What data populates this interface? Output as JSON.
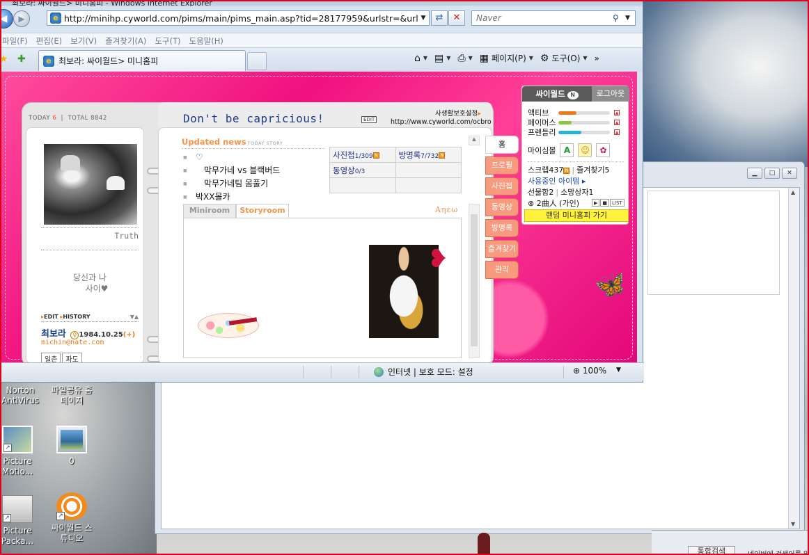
{
  "colors": {
    "border_red": "#d9041b",
    "cy_pink": "#f0117f",
    "title_blue": "#1c3a8c",
    "accent_orange": "#f4944d",
    "random_yellow": "#fff23c"
  },
  "window": {
    "title": "최보라: 싸이월드> 미니홈피 - Windows Internet Explorer"
  },
  "address_bar": {
    "url": "http://minihp.cyworld.com/pims/main/pims_main.asp?tid=28177959&urlstr=&urlstrsub=",
    "search_placeholder": "Naver"
  },
  "menu": [
    "파일(F)",
    "편집(E)",
    "보기(V)",
    "즐겨찾기(A)",
    "도구(T)",
    "도움말(H)"
  ],
  "tab": {
    "label": "최보라: 싸이월드> 미니홈피"
  },
  "command_bar": {
    "page_label": "페이지(P)",
    "tools_label": "도구(O)",
    "more": "»"
  },
  "minihompy": {
    "counter": {
      "today_label": "TODAY",
      "today_value": "6",
      "total_label": "TOTAL",
      "total_value": "8842"
    },
    "profile_caption": "Truth",
    "mood_line1": "당신과 나",
    "mood_line2": "사이♥",
    "edit_label": "EDIT",
    "history_label": "HISTORY",
    "owner_name": "최보라",
    "gender_mark": "♀",
    "birthday": "1984.10.25",
    "birthday_plus": "(+)",
    "email": "michin@nate.com",
    "btn_ilchon": "일촌",
    "btn_fa": "파도",
    "blog_title": "Don't be capricious!",
    "edit_btn": "EDIT",
    "privacy_label": "사생활보호설정",
    "homepage_url": "http://www.cyworld.com/ocbro",
    "updated_news": "Updated news",
    "today_story": "TODAY STORY",
    "news": [
      "♡",
      "막무가네 vs 블랙버드",
      "막무가네팀 몸풀기",
      "박XX몰카"
    ],
    "stats": [
      {
        "label": "사진첩",
        "count": "1/309"
      },
      {
        "label": "방명록",
        "count": "7/732"
      },
      {
        "label": "동영상",
        "count": "0/3"
      },
      {
        "label": "",
        "count": ""
      }
    ],
    "room_tabs": [
      "Miniroom",
      "Storyroom"
    ],
    "anew_label": "Aηεω",
    "side_tabs": [
      "홈",
      "프로필",
      "사진첩",
      "동영상",
      "방명록",
      "즐겨찾기",
      "관리"
    ]
  },
  "cy_panel": {
    "brand": "싸이월드",
    "brand_badge": "N",
    "logout": "로그아웃",
    "meters": [
      {
        "label": "액티브",
        "level": 0.35,
        "color": "#f07a1a"
      },
      {
        "label": "페이머스",
        "level": 0.25,
        "color": "#8cc63f"
      },
      {
        "label": "프렌들리",
        "level": 0.45,
        "color": "#27b2d8"
      }
    ],
    "mind_label": "마이심볼",
    "scrap_label": "스크랩437",
    "fav_label": "즐겨찾기5",
    "using_item": "사용중인 아이템",
    "gift": "선물함2",
    "wish": "소망상자1",
    "song": "2曲人 (가인)",
    "list_btn": "LIST",
    "random": "랜덤 미니홈피 가기"
  },
  "status_bar": {
    "zone": "인터넷 | 보호 모드: 설정",
    "zoom": "100%"
  },
  "desktop_icons": [
    {
      "label": "Norton AntiVirus"
    },
    {
      "label": "파일공유 홈페이지"
    },
    {
      "label": "Picture Motio..."
    },
    {
      "label": "0"
    },
    {
      "label": "Picture Packa..."
    },
    {
      "label": "싸이월드 스튜디오"
    }
  ],
  "bottom_window": {
    "tab": "통합검색",
    "text": "네이버에 검색어를 입력"
  }
}
